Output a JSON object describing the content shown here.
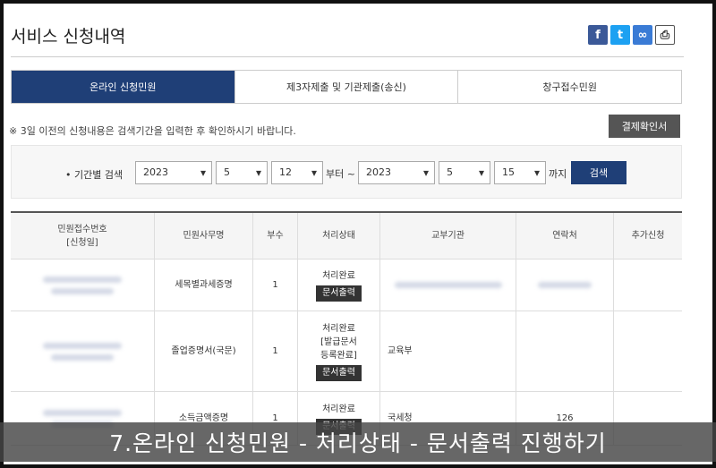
{
  "page": {
    "title": "서비스 신청내역"
  },
  "share_icons": [
    "facebook-icon",
    "twitter-icon",
    "link-icon",
    "print-icon"
  ],
  "tabs": [
    {
      "label": "온라인 신청민원",
      "active": true
    },
    {
      "label": "제3자제출 및 기관제출(송신)",
      "active": false
    },
    {
      "label": "창구접수민원",
      "active": false
    }
  ],
  "notice": "※ 3일 이전의 신청내용은 검색기간을 입력한 후 확인하시기 바랍니다.",
  "payment_button": "결제확인서",
  "search": {
    "label": "• 기간별 검색",
    "from_year": "2023",
    "from_month": "5",
    "from_day": "12",
    "from_suffix": "부터 ~",
    "to_year": "2023",
    "to_month": "5",
    "to_day": "15",
    "to_suffix": "까지",
    "button": "검색"
  },
  "table": {
    "headers": {
      "receipt_no": "민원접수번호",
      "receipt_date": "[신청일]",
      "name": "민원사무명",
      "copies": "부수",
      "status": "처리상태",
      "issuer": "교부기관",
      "contact": "연락처",
      "extra": "추가신청"
    },
    "rows": [
      {
        "name": "세목별과세증명",
        "copies": "1",
        "status_lines": [
          "처리완료"
        ],
        "button": "문서출력",
        "issuer": "",
        "contact": ""
      },
      {
        "name": "졸업증명서(국문)",
        "copies": "1",
        "status_lines": [
          "처리완료",
          "[발급문서",
          "등록완료]"
        ],
        "button": "문서출력",
        "issuer": "교육부",
        "contact": ""
      },
      {
        "name": "소득금액증명",
        "copies": "1",
        "status_lines": [
          "처리완료"
        ],
        "button": "문서출력",
        "issuer": "국세청",
        "contact": "126"
      }
    ]
  },
  "caption": "7.온라인 신청민원 - 처리상태 - 문서출력 진행하기",
  "colors": {
    "primary": "#1f3f77",
    "dark_button": "#333333",
    "facebook": "#3b5998",
    "twitter": "#1da1f2"
  }
}
